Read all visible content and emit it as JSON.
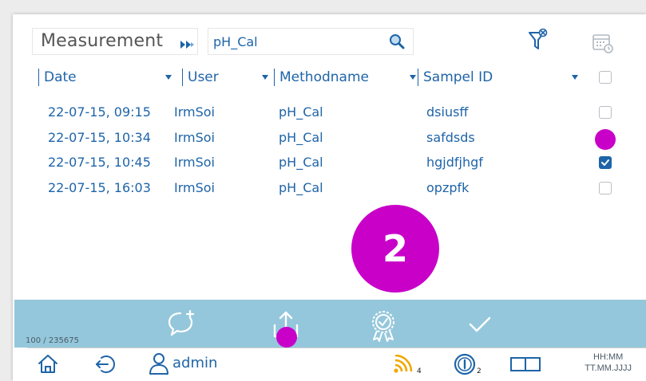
{
  "search": {
    "mode_label": "Measurement",
    "query_value": "pH_Cal",
    "query_placeholder": ""
  },
  "columns": [
    "Date",
    "User",
    "Methodname",
    "Sampel ID"
  ],
  "rows": [
    {
      "date": "22-07-15, 09:15",
      "user": "IrmSoi",
      "method": "pH_Cal",
      "sample_id": "dsiusff",
      "checked": false
    },
    {
      "date": "22-07-15, 10:34",
      "user": "IrmSoi",
      "method": "pH_Cal",
      "sample_id": "safdsds",
      "checked": false
    },
    {
      "date": "22-07-15, 10:45",
      "user": "IrmSoi",
      "method": "pH_Cal",
      "sample_id": "hgjdfjhgf",
      "checked": true
    },
    {
      "date": "22-07-15, 16:03",
      "user": "IrmSoi",
      "method": "pH_Cal",
      "sample_id": "opzpfk",
      "checked": false
    }
  ],
  "step_badge": "2",
  "toolbar": {
    "counter": "100 / 235675",
    "buttons": [
      "comment-add-icon",
      "upload-icon",
      "certificate-icon",
      "checkmark-icon"
    ]
  },
  "statusbar": {
    "user": "admin",
    "signal_count": "4",
    "info_count": "2",
    "time_placeholder": "HH:MM",
    "date_placeholder": "TT.MM.JJJJ"
  },
  "colors": {
    "accent": "#1e64a8",
    "toolbar_bg": "#94c7db",
    "highlight": "#c800c8",
    "signal": "#f0a800"
  }
}
